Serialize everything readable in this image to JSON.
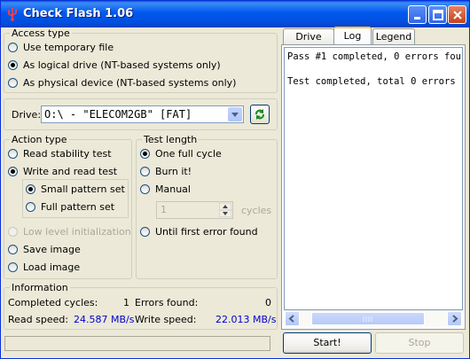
{
  "window": {
    "title": "Check Flash 1.06"
  },
  "access_type": {
    "legend": "Access type",
    "options": [
      "Use temporary file",
      "As logical drive (NT-based systems only)",
      "As physical device (NT-based systems only)"
    ],
    "selected": 1
  },
  "drive": {
    "label": "Drive:",
    "value": "O:\\ - \"ELECOM2GB\" [FAT]"
  },
  "action_type": {
    "legend": "Action type",
    "read_stability": "Read stability test",
    "write_read": "Write and read test",
    "small_pattern": "Small pattern set",
    "full_pattern": "Full pattern set",
    "low_level": "Low level initialization",
    "save_image": "Save image",
    "load_image": "Load image"
  },
  "test_length": {
    "legend": "Test length",
    "one_cycle": "One full cycle",
    "burn_it": "Burn it!",
    "manual": "Manual",
    "cycles_value": "1",
    "cycles_label": "cycles",
    "until_error": "Until first error found"
  },
  "information": {
    "legend": "Information",
    "completed_cycles_label": "Completed cycles:",
    "completed_cycles": "1",
    "errors_found_label": "Errors found:",
    "errors_found": "0",
    "read_speed_label": "Read speed:",
    "read_speed": "24.587 MB/s",
    "write_speed_label": "Write speed:",
    "write_speed": "22.013 MB/s"
  },
  "tabs": [
    "Drive map",
    "Log",
    "Legend"
  ],
  "log": {
    "lines": [
      "Pass #1 completed, 0 errors fou",
      "",
      "Test completed, total 0 errors"
    ]
  },
  "buttons": {
    "start": "Start!",
    "stop": "Stop"
  }
}
